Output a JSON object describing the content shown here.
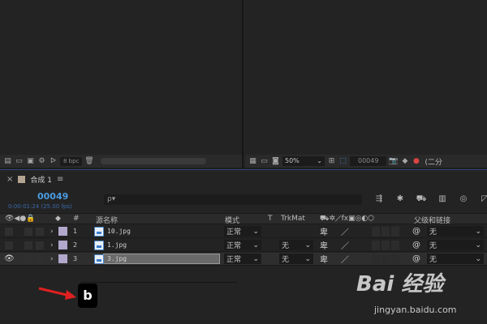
{
  "project_panel": {
    "bpc_label": "8 bpc"
  },
  "viewer": {
    "zoom": "50%",
    "timecode": "00049",
    "render_label": "(二分"
  },
  "timeline": {
    "tab_title": "合成 1",
    "timecode": "00049",
    "timecode_sub": "0:00:01:24 (25.00 fps)",
    "search_placeholder": "ρ▾",
    "headers": {
      "num": "#",
      "source_name": "源名称",
      "mode": "模式",
      "t": "T",
      "trkmat": "TrkMat",
      "parent": "父级和链接"
    },
    "layers": [
      {
        "num": "1",
        "source": "10.jpg",
        "mode": "正常",
        "trkmat": "",
        "parent": "无",
        "visible": false,
        "selected": false
      },
      {
        "num": "2",
        "source": "1.jpg",
        "mode": "正常",
        "trkmat": "无",
        "parent": "无",
        "visible": false,
        "selected": false
      },
      {
        "num": "3",
        "source": "3.jpg",
        "mode": "正常",
        "trkmat": "无",
        "parent": "无",
        "visible": true,
        "selected": true
      }
    ],
    "layer_color": "#b2a8cc"
  },
  "annotation": {
    "key_label": "b"
  },
  "watermark": {
    "logo": "Bai 经验",
    "url": "jingyan.baidu.com"
  }
}
